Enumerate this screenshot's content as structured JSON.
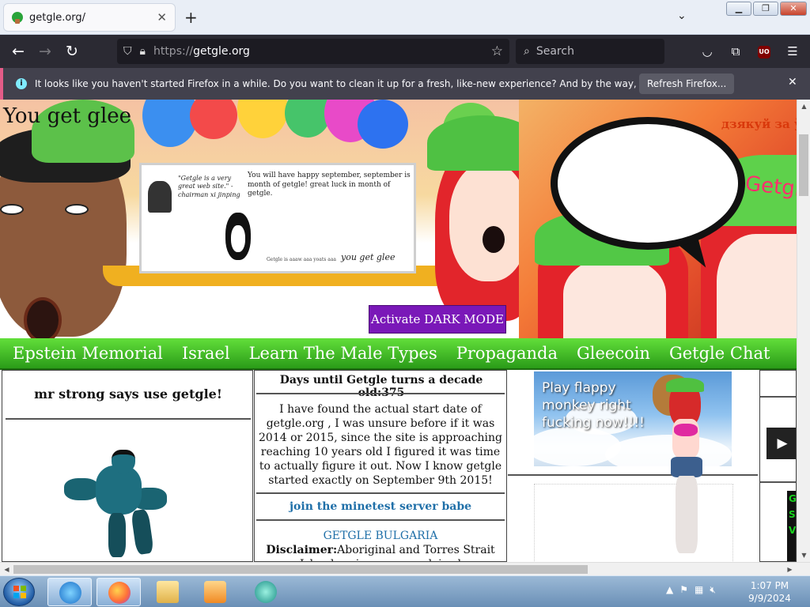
{
  "browser": {
    "tab_title": "getgle.org/",
    "url_proto": "https://",
    "url_host": "getgle.org",
    "search_placeholder": "Search",
    "notice_text": "It looks like you haven't started Firefox in a while. Do you want to clean it up for a fresh, like-new experience? And by the way, welcome back!",
    "refresh_button": "Refresh Firefox...",
    "ublock_label": "UO",
    "icons": [
      "back-icon",
      "forward-icon",
      "reload-icon",
      "shield-icon",
      "lock-icon",
      "star-icon",
      "search-icon",
      "pocket-icon",
      "extensions-icon",
      "ublock-icon",
      "menu-icon"
    ]
  },
  "hero": {
    "title": "You get glee",
    "russian_text": "дзякуй за ўсё",
    "board_quote": "\"Getgle is a very great web site.\" - chairman xi jinping",
    "board_text": "You will have happy september, september is month of getgle! great luck in month of getgle.",
    "board_small": "Getgle is aaaw aaa yoats aaa",
    "board_sign": "you get glee",
    "cap_text": "Getgle",
    "dark_mode_button": "Activate DARK MODE"
  },
  "menu": {
    "items": [
      "Epstein Memorial",
      "Israel",
      "Learn The Male Types",
      "Propaganda",
      "Gleecoin",
      "Getgle Chat"
    ]
  },
  "col1": {
    "heading": "mr strong says use getgle!"
  },
  "col2": {
    "countdown": "Days until Getgle turns a decade old:375",
    "paragraph": "I have found the actual start date of getgle.org , I was unsure before if it was 2014 or 2015, since the site is approaching reaching 10 years old I figured it was time to actually figure it out. Now I know getgle started exactly on September 9th 2015!",
    "link": "join the minetest server babe",
    "bulgaria": "GETGLE BULGARIA",
    "disclaimer_label": "Disclaimer:",
    "disclaimer_text": "Aboriginal and Torres Strait Islander viewers are advised"
  },
  "col3": {
    "ad_text": "Play flappy monkey right fucking now!!!!"
  },
  "col4": {
    "play_icon": "▶",
    "tiny_ad_letters": "G\nS\nV"
  },
  "taskbar": {
    "time": "1:07 PM",
    "date": "9/9/2024",
    "apps": [
      "internet-explorer",
      "firefox",
      "file-explorer",
      "media-player",
      "app-icon"
    ]
  }
}
